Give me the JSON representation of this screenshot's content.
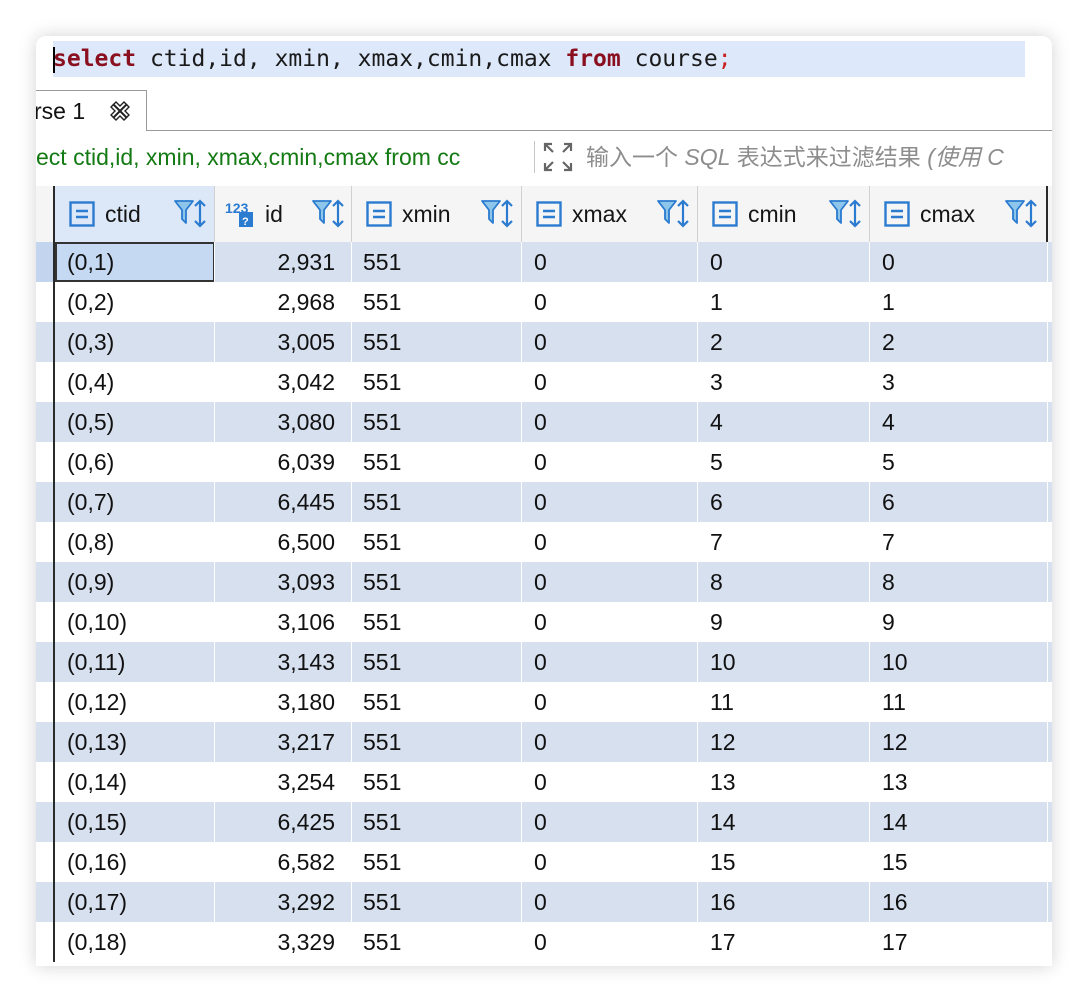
{
  "editor": {
    "kw_select": "select",
    "sql_cols": " ctid,id, xmin, xmax,cmin,cmax ",
    "kw_from": "from",
    "table": " course",
    "semicolon": ";"
  },
  "result_tab": {
    "label": "rse 1"
  },
  "filter": {
    "query_text": "ect ctid,id, xmin, xmax,cmin,cmax from cc",
    "placeholder_prefix": "输入一个 ",
    "placeholder_sql": "SQL",
    "placeholder_mid": " 表达式来过滤结果 ",
    "placeholder_suffix": "(使用 C"
  },
  "columns": [
    {
      "name": "ctid",
      "type_icon": "text-icon"
    },
    {
      "name": "id",
      "type_icon": "numeric-icon"
    },
    {
      "name": "xmin",
      "type_icon": "text-icon"
    },
    {
      "name": "xmax",
      "type_icon": "text-icon"
    },
    {
      "name": "cmin",
      "type_icon": "text-icon"
    },
    {
      "name": "cmax",
      "type_icon": "text-icon"
    }
  ],
  "numeric_icon_text": "123",
  "rows": [
    [
      "(0,1)",
      "2,931",
      "551",
      "0",
      "0",
      "0"
    ],
    [
      "(0,2)",
      "2,968",
      "551",
      "0",
      "1",
      "1"
    ],
    [
      "(0,3)",
      "3,005",
      "551",
      "0",
      "2",
      "2"
    ],
    [
      "(0,4)",
      "3,042",
      "551",
      "0",
      "3",
      "3"
    ],
    [
      "(0,5)",
      "3,080",
      "551",
      "0",
      "4",
      "4"
    ],
    [
      "(0,6)",
      "6,039",
      "551",
      "0",
      "5",
      "5"
    ],
    [
      "(0,7)",
      "6,445",
      "551",
      "0",
      "6",
      "6"
    ],
    [
      "(0,8)",
      "6,500",
      "551",
      "0",
      "7",
      "7"
    ],
    [
      "(0,9)",
      "3,093",
      "551",
      "0",
      "8",
      "8"
    ],
    [
      "(0,10)",
      "3,106",
      "551",
      "0",
      "9",
      "9"
    ],
    [
      "(0,11)",
      "3,143",
      "551",
      "0",
      "10",
      "10"
    ],
    [
      "(0,12)",
      "3,180",
      "551",
      "0",
      "11",
      "11"
    ],
    [
      "(0,13)",
      "3,217",
      "551",
      "0",
      "12",
      "12"
    ],
    [
      "(0,14)",
      "3,254",
      "551",
      "0",
      "13",
      "13"
    ],
    [
      "(0,15)",
      "6,425",
      "551",
      "0",
      "14",
      "14"
    ],
    [
      "(0,16)",
      "6,582",
      "551",
      "0",
      "15",
      "15"
    ],
    [
      "(0,17)",
      "3,292",
      "551",
      "0",
      "16",
      "16"
    ],
    [
      "(0,18)",
      "3,329",
      "551",
      "0",
      "17",
      "17"
    ]
  ],
  "colors": {
    "keyword": "#8a1020",
    "filter_query": "#147a14",
    "row_alt": "#d6e0ef",
    "icon_blue": "#2b7bd0"
  }
}
